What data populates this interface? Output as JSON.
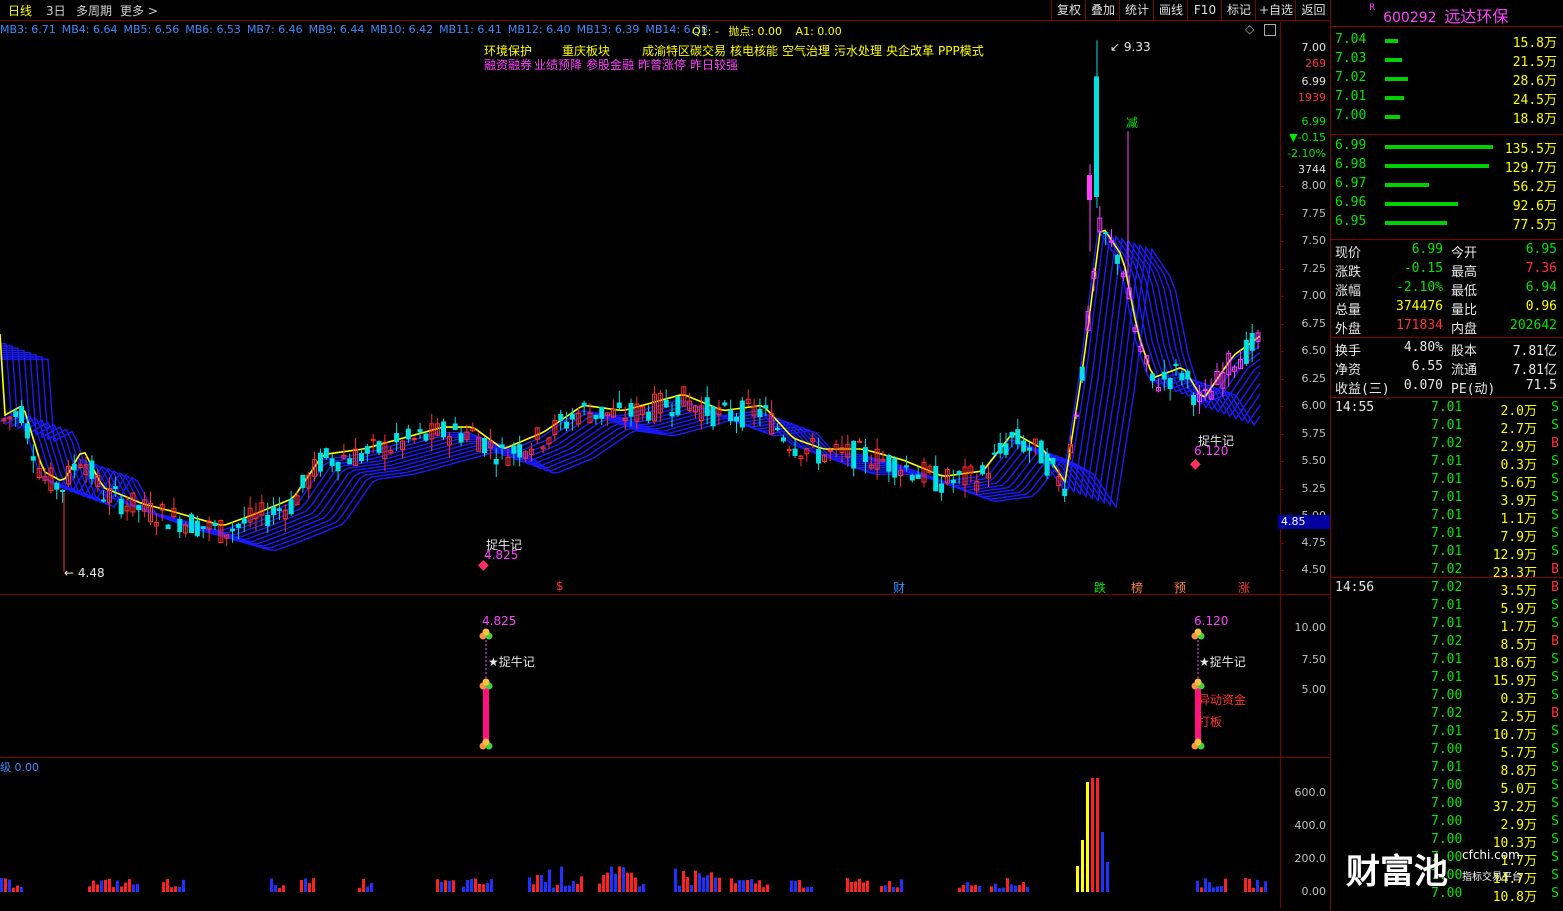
{
  "topbar": {
    "period_tabs": [
      "日线",
      "3日",
      "多周期",
      "更多 >"
    ],
    "buttons": [
      "复权",
      "叠加",
      "统计",
      "画线",
      "F10",
      "标记",
      "+自选",
      "返回"
    ]
  },
  "stock": {
    "flag": "R",
    "code": "600292",
    "name": "远达环保"
  },
  "ma_line": [
    "MB3: 6.71",
    "MB4: 6.64",
    "MB5: 6.56",
    "MB6: 6.53",
    "MB7: 6.46",
    "MB9: 6.44",
    "MB10: 6.42",
    "MB11: 6.41",
    "MB12: 6.40",
    "MB13: 6.39",
    "MB14: 6.38"
  ],
  "indicator_line": {
    "q1": "Q1: -",
    "point": "抛点: 0.00",
    "a1": "A1: 0.00"
  },
  "tags_row1": [
    "环境保护",
    "重庆板块",
    "成渝特区",
    "碳交易",
    "核电核能",
    "空气治理",
    "污水处理",
    "央企改革",
    "PPP模式"
  ],
  "tags_row2": [
    "融资融券",
    "业绩预降",
    "参股金融",
    "昨曾涨停",
    "昨日较强"
  ],
  "main_chart": {
    "high_label": "9.33",
    "low_label": "4.48",
    "signal_label": "捉牛记",
    "signal1_price": "4.825",
    "signal2_price": "6.120",
    "jian_label": "减",
    "event_markers": [
      {
        "text": "$",
        "color": "#ff3030"
      },
      {
        "text": "财",
        "color": "#3a8cff"
      },
      {
        "text": "跌",
        "color": "#00e600"
      },
      {
        "text": "榜",
        "color": "#ff8040"
      },
      {
        "text": "预",
        "color": "#ff8040"
      },
      {
        "text": "涨",
        "color": "#ff3030"
      }
    ],
    "y_ticks": [
      "8.00",
      "7.75",
      "7.50",
      "7.25",
      "7.00",
      "6.75",
      "6.50",
      "6.25",
      "6.00",
      "5.75",
      "5.50",
      "5.25",
      "5.00",
      "4.75",
      "4.50"
    ],
    "current_price_tag": "4.85",
    "right_axis_info": [
      "7.00",
      "269",
      "6.99",
      "1939",
      "6.99",
      "▼-0.15",
      "-2.10%",
      "3744"
    ]
  },
  "sub_chart": {
    "price1": "4.825",
    "price2": "6.120",
    "label": "★捉牛记",
    "label2_a": "异动资金",
    "label2_b": "打板",
    "y_ticks": [
      "10.00",
      "7.50",
      "5.00"
    ]
  },
  "vol_chart": {
    "header": "级  0.00",
    "y_ticks": [
      "600.0",
      "400.0",
      "200.0",
      "0.00"
    ]
  },
  "order_book": {
    "asks": [
      {
        "price": "7.04",
        "vol": "15.8万",
        "level": 0.12
      },
      {
        "price": "7.03",
        "vol": "21.5万",
        "level": 0.16
      },
      {
        "price": "7.02",
        "vol": "28.6万",
        "level": 0.21
      },
      {
        "price": "7.01",
        "vol": "24.5万",
        "level": 0.18
      },
      {
        "price": "7.00",
        "vol": "18.8万",
        "level": 0.14
      }
    ],
    "bids": [
      {
        "price": "6.99",
        "vol": "135.5万",
        "level": 1.0
      },
      {
        "price": "6.98",
        "vol": "129.7万",
        "level": 0.96
      },
      {
        "price": "6.97",
        "vol": "56.2万",
        "level": 0.41
      },
      {
        "price": "6.96",
        "vol": "92.6万",
        "level": 0.68
      },
      {
        "price": "6.95",
        "vol": "77.5万",
        "level": 0.57
      }
    ]
  },
  "quote": [
    {
      "l": "现价",
      "v": "6.99",
      "vc": "#00e600",
      "l2": "今开",
      "v2": "6.95",
      "v2c": "#00e600"
    },
    {
      "l": "涨跌",
      "v": "-0.15",
      "vc": "#00e600",
      "l2": "最高",
      "v2": "7.36",
      "v2c": "#ff3030"
    },
    {
      "l": "涨幅",
      "v": "-2.10%",
      "vc": "#00e600",
      "l2": "最低",
      "v2": "6.94",
      "v2c": "#00e600"
    },
    {
      "l": "总量",
      "v": "374476",
      "vc": "#ffff00",
      "l2": "量比",
      "v2": "0.96",
      "v2c": "#ffff00"
    },
    {
      "l": "外盘",
      "v": "171834",
      "vc": "#ff3030",
      "l2": "内盘",
      "v2": "202642",
      "v2c": "#00e600"
    }
  ],
  "quote2": [
    {
      "l": "换手",
      "v": "4.80%",
      "l2": "股本",
      "v2": "7.81亿"
    },
    {
      "l": "净资",
      "v": "6.55",
      "l2": "流通",
      "v2": "7.81亿"
    },
    {
      "l": "收益(三)",
      "v": "0.070",
      "l2": "PE(动)",
      "v2": "71.5"
    }
  ],
  "ticks_1455": {
    "time": "14:55",
    "rows": [
      {
        "p": "7.01",
        "v": "2.0万",
        "s": "S"
      },
      {
        "p": "7.01",
        "v": "2.7万",
        "s": "S"
      },
      {
        "p": "7.02",
        "v": "2.9万",
        "s": "B"
      },
      {
        "p": "7.01",
        "v": "0.3万",
        "s": "S"
      },
      {
        "p": "7.01",
        "v": "5.6万",
        "s": "S"
      },
      {
        "p": "7.01",
        "v": "3.9万",
        "s": "S"
      },
      {
        "p": "7.01",
        "v": "1.1万",
        "s": "S"
      },
      {
        "p": "7.01",
        "v": "7.9万",
        "s": "S"
      },
      {
        "p": "7.01",
        "v": "12.9万",
        "s": "S"
      },
      {
        "p": "7.02",
        "v": "23.3万",
        "s": "B"
      }
    ]
  },
  "ticks_1456": {
    "time": "14:56",
    "rows": [
      {
        "p": "7.02",
        "v": "3.5万",
        "s": "B"
      },
      {
        "p": "7.01",
        "v": "5.9万",
        "s": "S"
      },
      {
        "p": "7.01",
        "v": "1.7万",
        "s": "S"
      },
      {
        "p": "7.02",
        "v": "8.5万",
        "s": "B"
      },
      {
        "p": "7.01",
        "v": "18.6万",
        "s": "S"
      },
      {
        "p": "7.01",
        "v": "15.9万",
        "s": "S"
      },
      {
        "p": "7.00",
        "v": "0.3万",
        "s": "S"
      },
      {
        "p": "7.02",
        "v": "2.5万",
        "s": "B"
      },
      {
        "p": "7.01",
        "v": "10.7万",
        "s": "S"
      },
      {
        "p": "7.00",
        "v": "5.7万",
        "s": "S"
      },
      {
        "p": "7.01",
        "v": "8.8万",
        "s": "S"
      },
      {
        "p": "7.00",
        "v": "5.0万",
        "s": "S"
      },
      {
        "p": "7.00",
        "v": "37.2万",
        "s": "S"
      },
      {
        "p": "7.00",
        "v": "2.9万",
        "s": "S"
      },
      {
        "p": "7.00",
        "v": "10.3万",
        "s": "S"
      },
      {
        "p": "7.00",
        "v": "1.7万",
        "s": "S"
      },
      {
        "p": "7.00",
        "v": "14.7万",
        "s": "S"
      },
      {
        "p": "7.00",
        "v": "10.8万",
        "s": "S"
      }
    ]
  },
  "watermark": {
    "brand": "财富池",
    "domain": "cfchi.com",
    "sub": "指标交易平台"
  },
  "colors": {
    "up": "#ff3030",
    "down": "#00e600",
    "cyan": "#00e0e0",
    "ribbon": "#1010ff",
    "ma_yellow": "#ffff00"
  }
}
